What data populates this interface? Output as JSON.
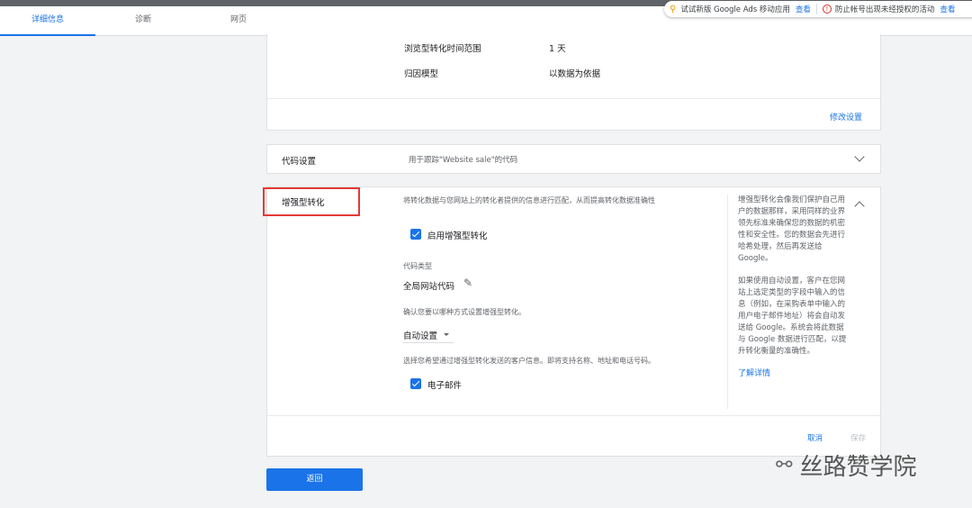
{
  "tabs": [
    "详细信息",
    "诊断",
    "网页"
  ],
  "notices": {
    "text1": "试试新版 Google Ads 移动应用",
    "link1": "查看",
    "text2": "防止帐号出现未经授权的活动",
    "link2": "查看"
  },
  "settings": {
    "rows": [
      {
        "label": "浏览型转化时间范围",
        "value": "1 天"
      },
      {
        "label": "归因模型",
        "value": "以数据为依据"
      }
    ],
    "edit_link": "修改设置"
  },
  "tag_setup": {
    "title": "代码设置",
    "description": "用于跟踪\"Website sale\"的代码"
  },
  "enhanced": {
    "title": "增强型转化",
    "description": "将转化数据与您网站上的转化者提供的信息进行匹配，从而提高转化数据准确性",
    "enable_label": "启用增强型转化",
    "tag_type_label": "代码类型",
    "tag_type_value": "全局网站代码",
    "setup_prompt": "确认您要以哪种方式设置增强型转化。",
    "setup_value": "自动设置",
    "customer_info_prompt": "选择您希望通过增强型转化发送的客户信息。即将支持名称、地址和电话号码。",
    "email_label": "电子邮件",
    "side_p1": "增强型转化会像我们保护自己用户的数据那样，采用同样的业界领先标准来确保您的数据的机密性和安全性。您的数据会先进行哈希处理，然后再发送给 Google。",
    "side_p2": "如果使用自动设置，客户在您网站上选定类型的字段中输入的信息（例如，在采购表单中输入的用户电子邮件地址）将会自动发送给 Google。系统会将此数据与 Google 数据进行匹配，以提升转化衡量的准确性。",
    "learn_more": "了解详情",
    "cancel": "取消",
    "save": "保存"
  },
  "back_button": "返回",
  "watermark": "丝路赞学院",
  "colors": {
    "accent": "#1a73e8",
    "highlight": "#e53935"
  }
}
